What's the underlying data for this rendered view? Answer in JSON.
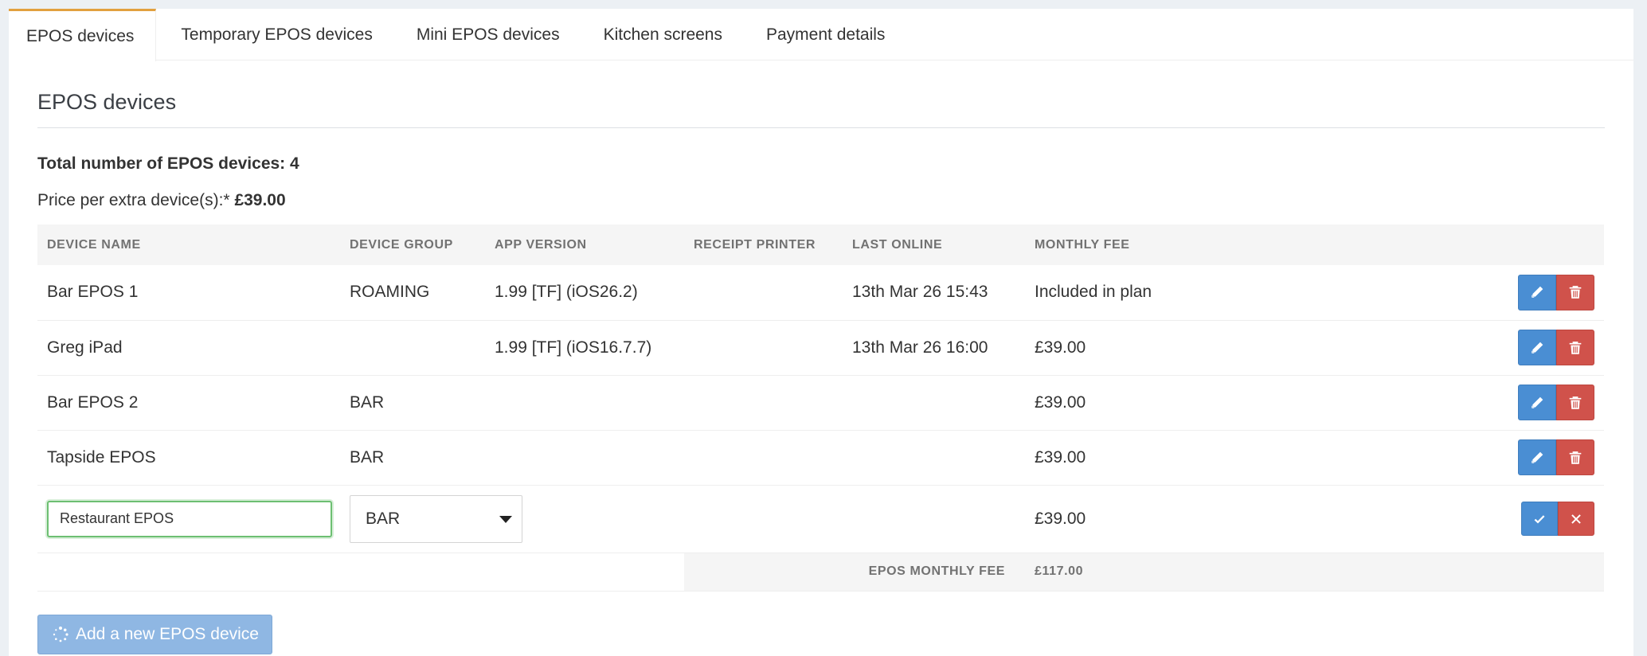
{
  "tabs": [
    {
      "label": "EPOS devices",
      "active": true
    },
    {
      "label": "Temporary EPOS devices",
      "active": false
    },
    {
      "label": "Mini EPOS devices",
      "active": false
    },
    {
      "label": "Kitchen screens",
      "active": false
    },
    {
      "label": "Payment details",
      "active": false
    }
  ],
  "section": {
    "title": "EPOS devices",
    "total_label": "Total number of EPOS devices: 4",
    "price_label": "Price per extra device(s):*",
    "price_value": "£39.00"
  },
  "table": {
    "headers": [
      "DEVICE NAME",
      "DEVICE GROUP",
      "APP VERSION",
      "RECEIPT PRINTER",
      "LAST ONLINE",
      "MONTHLY FEE"
    ],
    "rows": [
      {
        "name": "Bar EPOS 1",
        "group": "ROAMING",
        "app_version": "1.99 [TF] (iOS26.2)",
        "printer": "",
        "last_online": "13th Mar 26 15:43",
        "fee": "Included in plan"
      },
      {
        "name": "Greg iPad",
        "group": "",
        "app_version": "1.99 [TF] (iOS16.7.7)",
        "printer": "",
        "last_online": "13th Mar 26 16:00",
        "fee": "£39.00"
      },
      {
        "name": "Bar EPOS 2",
        "group": "BAR",
        "app_version": "",
        "printer": "",
        "last_online": "",
        "fee": "£39.00"
      },
      {
        "name": "Tapside EPOS",
        "group": "BAR",
        "app_version": "",
        "printer": "",
        "last_online": "",
        "fee": "£39.00"
      }
    ],
    "edit_row": {
      "name_value": "Restaurant EPOS",
      "group_selected": "BAR",
      "fee": "£39.00"
    },
    "summary": {
      "label": "EPOS MONTHLY FEE",
      "value": "£117.00"
    }
  },
  "add_button": {
    "label": "Add a new EPOS device"
  },
  "colors": {
    "accent_tab": "#e2a03f",
    "edit_blue": "#4a8ed3",
    "delete_red": "#d0524b",
    "input_focus_green": "#6dbf72",
    "add_button_disabled": "#8fb7e3"
  }
}
